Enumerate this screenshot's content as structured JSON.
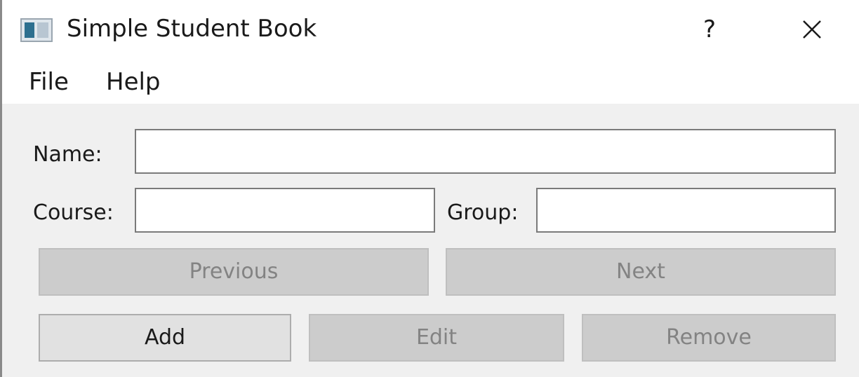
{
  "window": {
    "title": "Simple Student Book",
    "help_label": "?"
  },
  "menu": {
    "items": [
      {
        "label": "File"
      },
      {
        "label": "Help"
      }
    ]
  },
  "form": {
    "name_label": "Name:",
    "name_value": "",
    "course_label": "Course:",
    "course_value": "",
    "group_label": "Group:",
    "group_value": ""
  },
  "nav": {
    "previous_label": "Previous",
    "next_label": "Next"
  },
  "actions": {
    "add_label": "Add",
    "edit_label": "Edit",
    "remove_label": "Remove"
  }
}
